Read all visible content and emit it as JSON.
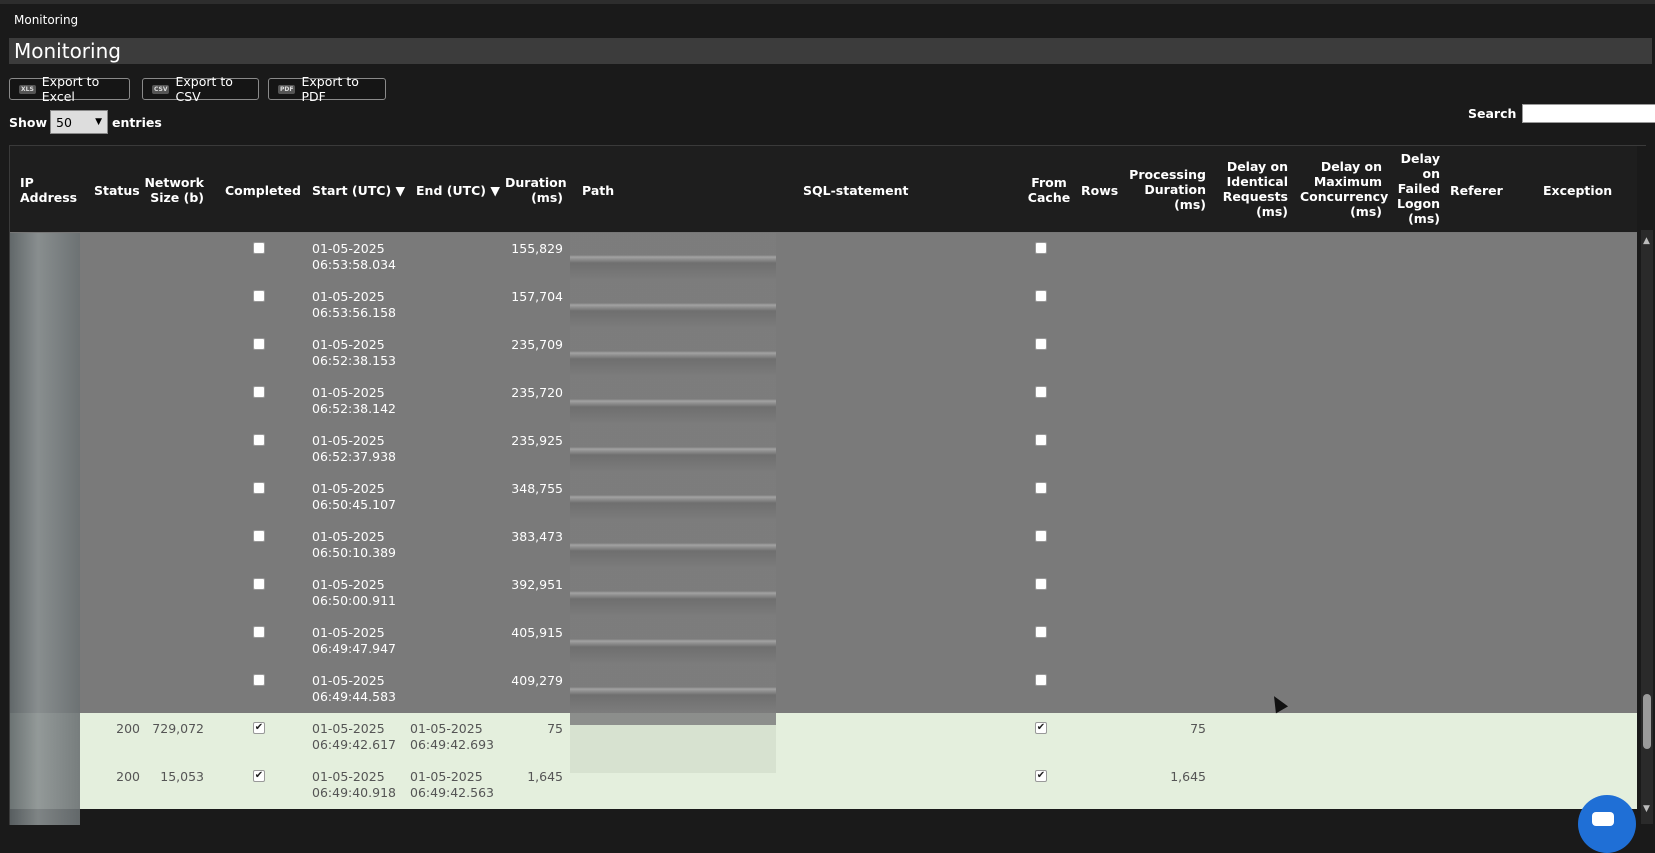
{
  "breadcrumb": "Monitoring",
  "page_title": "Monitoring",
  "toolbar": {
    "excel": {
      "badge": "XLS",
      "label": "Export to Excel"
    },
    "csv": {
      "badge": "CSV",
      "label": "Export to CSV"
    },
    "pdf": {
      "badge": "PDF",
      "label": "Export to PDF"
    }
  },
  "length": {
    "show": "Show",
    "value": "50",
    "entries": "entries"
  },
  "search": {
    "label": "Search",
    "value": ""
  },
  "columns": {
    "ip": [
      "IP",
      "Address"
    ],
    "status": [
      "Status"
    ],
    "network": [
      "Network",
      "Size (b)"
    ],
    "completed": [
      "Completed"
    ],
    "start": [
      "Start (UTC) ▼"
    ],
    "end": [
      "End (UTC) ▼"
    ],
    "duration": [
      "Duration",
      "(ms)"
    ],
    "path": [
      "Path"
    ],
    "sql": [
      "SQL-statement"
    ],
    "cache": [
      "From",
      "Cache"
    ],
    "rows": [
      "Rows"
    ],
    "proc": [
      "Processing",
      "Duration",
      "(ms)"
    ],
    "identical": [
      "Delay on",
      "Identical",
      "Requests",
      "(ms)"
    ],
    "concurrency": [
      "Delay on",
      "Maximum",
      "Concurrency",
      "(ms)"
    ],
    "failed": [
      "Delay",
      "on",
      "Failed",
      "Logon",
      "(ms)"
    ],
    "referer": [
      "Referer"
    ],
    "exception": [
      "Exception"
    ]
  },
  "rows": [
    {
      "status": "",
      "size": "",
      "completed": false,
      "start": [
        "01-05-2025",
        "06:53:58.034"
      ],
      "end": [
        "",
        ""
      ],
      "duration": "155,829",
      "cache": false,
      "proc": "",
      "style": "gray"
    },
    {
      "status": "",
      "size": "",
      "completed": false,
      "start": [
        "01-05-2025",
        "06:53:56.158"
      ],
      "end": [
        "",
        ""
      ],
      "duration": "157,704",
      "cache": false,
      "proc": "",
      "style": "gray"
    },
    {
      "status": "",
      "size": "",
      "completed": false,
      "start": [
        "01-05-2025",
        "06:52:38.153"
      ],
      "end": [
        "",
        ""
      ],
      "duration": "235,709",
      "cache": false,
      "proc": "",
      "style": "gray"
    },
    {
      "status": "",
      "size": "",
      "completed": false,
      "start": [
        "01-05-2025",
        "06:52:38.142"
      ],
      "end": [
        "",
        ""
      ],
      "duration": "235,720",
      "cache": false,
      "proc": "",
      "style": "gray"
    },
    {
      "status": "",
      "size": "",
      "completed": false,
      "start": [
        "01-05-2025",
        "06:52:37.938"
      ],
      "end": [
        "",
        ""
      ],
      "duration": "235,925",
      "cache": false,
      "proc": "",
      "style": "gray"
    },
    {
      "status": "",
      "size": "",
      "completed": false,
      "start": [
        "01-05-2025",
        "06:50:45.107"
      ],
      "end": [
        "",
        ""
      ],
      "duration": "348,755",
      "cache": false,
      "proc": "",
      "style": "gray"
    },
    {
      "status": "",
      "size": "",
      "completed": false,
      "start": [
        "01-05-2025",
        "06:50:10.389"
      ],
      "end": [
        "",
        ""
      ],
      "duration": "383,473",
      "cache": false,
      "proc": "",
      "style": "gray"
    },
    {
      "status": "",
      "size": "",
      "completed": false,
      "start": [
        "01-05-2025",
        "06:50:00.911"
      ],
      "end": [
        "",
        ""
      ],
      "duration": "392,951",
      "cache": false,
      "proc": "",
      "style": "gray"
    },
    {
      "status": "",
      "size": "",
      "completed": false,
      "start": [
        "01-05-2025",
        "06:49:47.947"
      ],
      "end": [
        "",
        ""
      ],
      "duration": "405,915",
      "cache": false,
      "proc": "",
      "style": "gray"
    },
    {
      "status": "",
      "size": "",
      "completed": false,
      "start": [
        "01-05-2025",
        "06:49:44.583"
      ],
      "end": [
        "",
        ""
      ],
      "duration": "409,279",
      "cache": false,
      "proc": "",
      "style": "gray"
    },
    {
      "status": "200",
      "size": "729,072",
      "completed": true,
      "start": [
        "01-05-2025",
        "06:49:42.617"
      ],
      "end": [
        "01-05-2025",
        "06:49:42.693"
      ],
      "duration": "75",
      "cache": true,
      "proc": "75",
      "style": "green"
    },
    {
      "status": "200",
      "size": "15,053",
      "completed": true,
      "start": [
        "01-05-2025",
        "06:49:40.918"
      ],
      "end": [
        "01-05-2025",
        "06:49:42.563"
      ],
      "duration": "1,645",
      "cache": true,
      "proc": "1,645",
      "style": "green"
    }
  ]
}
